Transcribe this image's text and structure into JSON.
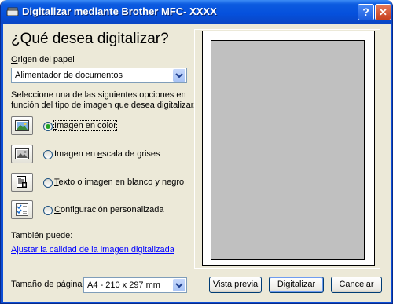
{
  "window": {
    "title": "Digitalizar mediante Brother MFC- XXXX",
    "help_label": "?",
    "close_label": "✕"
  },
  "heading": "¿Qué desea digitalizar?",
  "paper_source": {
    "label_first": "O",
    "label_rest": "rigen del papel",
    "value": "Alimentador de documentos"
  },
  "instructions": {
    "line1": "Seleccione una de las siguientes opciones en",
    "line2": "función del tipo de imagen que desea digitalizar."
  },
  "options": [
    {
      "pre": "",
      "key": "I",
      "post": "magen en color",
      "selected": true
    },
    {
      "pre": "Imagen en ",
      "key": "e",
      "post": "scala de grises",
      "selected": false
    },
    {
      "pre": "",
      "key": "T",
      "post": "exto o imagen en blanco y negro",
      "selected": false
    },
    {
      "pre": "",
      "key": "C",
      "post": "onfiguración personalizada",
      "selected": false
    }
  ],
  "also": {
    "label": "También puede:",
    "link": "Ajustar la calidad de la imagen digitalizada"
  },
  "page_size": {
    "label_pre": "Tamaño de ",
    "label_key": "p",
    "label_post": "ágina:",
    "value": "A4 - 210 x 297 mm"
  },
  "buttons": {
    "preview": {
      "key": "V",
      "rest": "ista previa"
    },
    "scan": {
      "key": "D",
      "rest": "igitalizar"
    },
    "cancel": "Cancelar"
  },
  "colors": {
    "titlebar": "#0550dc",
    "dialog_bg": "#ece9d8",
    "link": "#0000ff",
    "preview_gray": "#c0c0c0"
  },
  "icons": [
    "scanner-icon",
    "help-icon",
    "close-icon",
    "chevron-down-icon",
    "color-photo-icon",
    "grayscale-photo-icon",
    "text-document-icon",
    "custom-settings-icon"
  ]
}
